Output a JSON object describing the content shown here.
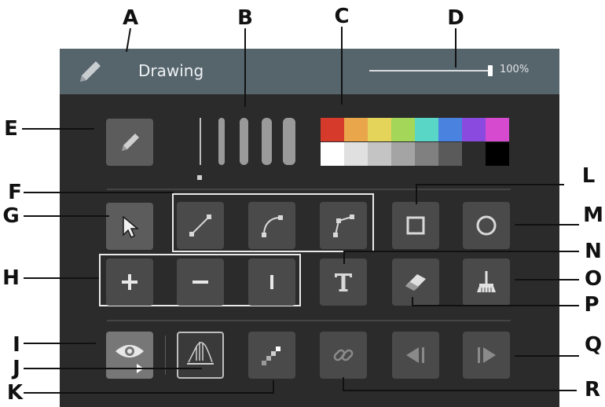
{
  "callouts": [
    "A",
    "B",
    "C",
    "D",
    "E",
    "F",
    "G",
    "H",
    "I",
    "J",
    "K",
    "L",
    "M",
    "N",
    "O",
    "P",
    "Q",
    "R"
  ],
  "titlebar": {
    "title": "Drawing",
    "icon": "pencil-icon",
    "zoom_label": "100%",
    "zoom_level": 1.0
  },
  "palette": {
    "top_row": [
      "#d63a2a",
      "#eaa64a",
      "#e4d45a",
      "#a4d65a",
      "#5ad6c6",
      "#4a82e0",
      "#8a4ae0",
      "#d64ad0"
    ],
    "bottom_row": [
      "#ffffff",
      "#e0e0e0",
      "#c4c4c4",
      "#a4a4a4",
      "#808080",
      "#5a5a5a",
      "#2b2b2b",
      "#000000"
    ]
  },
  "tools": {
    "pencil": "pencil-icon",
    "select": "cursor-icon",
    "line": "line-icon",
    "curve": "curve-icon",
    "polyline": "polyline-icon",
    "rectangle": "square-icon",
    "ellipse": "circle-icon",
    "add": "plus-icon",
    "remove": "minus-icon",
    "split": "bar-icon",
    "text": "text-icon",
    "eraser": "eraser-icon",
    "clear": "broom-icon",
    "show": "eye-play-icon",
    "graph": "graph-icon",
    "stairs": "stairs-icon",
    "link": "link-icon",
    "prev": "prev-icon",
    "next": "next-icon"
  }
}
